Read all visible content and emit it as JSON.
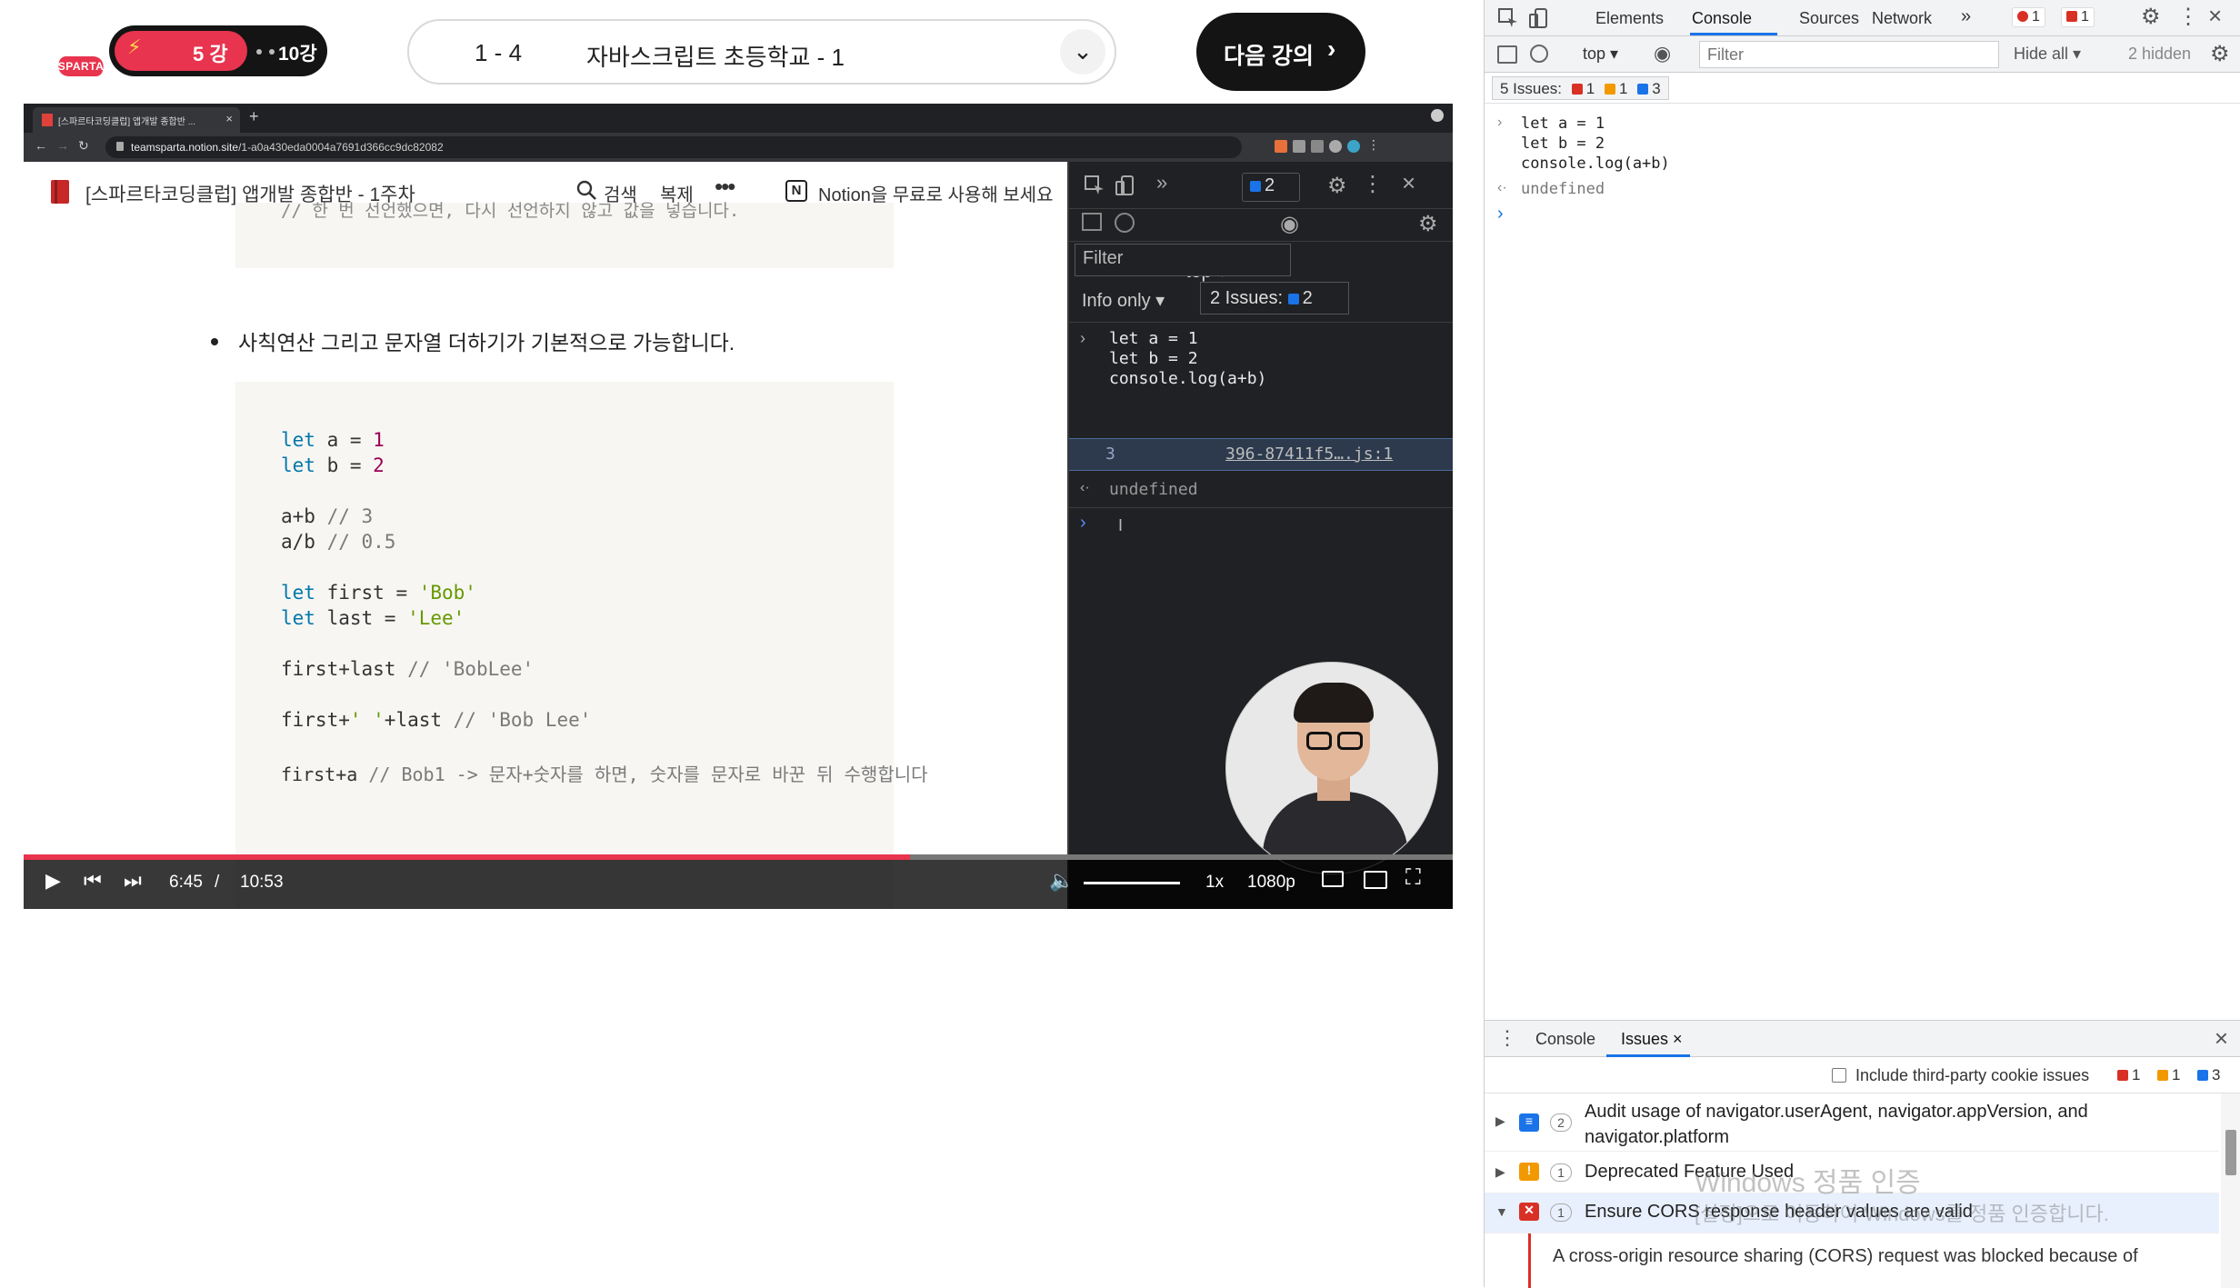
{
  "header": {
    "logo_text": "SPARTA",
    "current_lesson": "5 강",
    "total_lessons": "10강",
    "progress_icon": "lightning-bolt-icon",
    "lesson_number": "1 - 4",
    "lesson_title": "자바스크립트 초등학교 - 1",
    "next_button": "다음 강의",
    "next_icon": "chevron-right-icon",
    "accent_color": "#e8344e"
  },
  "browser": {
    "tab_title": "[스파르타코딩클럽] 앱개발 종합반 ...",
    "url_domain": "teamsparta.notion.site",
    "url_path": "/1-a0a430eda0004a7691d366cc9dc82082"
  },
  "notion": {
    "page_title": "[스파르타코딩클럽] 앱개발 종합반 - 1주차",
    "search": "검색",
    "duplicate": "복제",
    "more": "•••",
    "logo_letter": "N",
    "cta": "Notion을 무료로 사용해 보세요",
    "prev_code_line": "// 한 번 선언했으면, 다시 선언하지 않고 값을 넣습니다.",
    "bullet_text": "사칙연산 그리고 문자열 더하기가 기본적으로 가능합니다.",
    "code": {
      "l1_kw": "let",
      "l1_rest": " a = ",
      "l1_num": "1",
      "l2_kw": "let",
      "l2_rest": " b = ",
      "l2_num": "2",
      "l3": "a+b",
      "l3_cm": " // 3",
      "l4": "a/b",
      "l4_cm": " // 0.5",
      "l5_kw": "let",
      "l5_rest": " first = ",
      "l5_str": "'Bob'",
      "l6_kw": "let",
      "l6_rest": " last = ",
      "l6_str": "'Lee'",
      "l7": "first+last",
      "l7_cm": " // 'BobLee'",
      "l8a": "first+",
      "l8_str": "' '",
      "l8b": "+last",
      "l8_cm": " // 'Bob Lee'",
      "l9": "first+a",
      "l9_cm": " // Bob1 -> 문자+숫자를 하면, 숫자를 문자로 바꾼 뒤 수행합니다"
    }
  },
  "video_devtools": {
    "issues_count": "2",
    "context": "top",
    "filter_placeholder": "Filter",
    "log_level": "Info only",
    "issues_label": "2 Issues:",
    "issues_num": "2",
    "code_l1": "let a = 1",
    "code_l2": "let b = 2",
    "code_l3": "console.log(a+b)",
    "result": "3",
    "source": "396-87411f5….js:1",
    "undefined": "undefined"
  },
  "player": {
    "time_current": "6:45",
    "time_separator": "/",
    "time_total": "10:53",
    "progress_fraction": 0.62,
    "speed": "1x",
    "quality": "1080p"
  },
  "devtools": {
    "tabs": [
      "Elements",
      "Console",
      "Sources",
      "Network"
    ],
    "more_tabs": "»",
    "error_badge": "1",
    "issue_badge": "1",
    "context": "top",
    "filter_placeholder": "Filter",
    "hide_all": "Hide all",
    "hidden_count": "2 hidden",
    "issues_summary": "5 Issues:",
    "issues_red": "1",
    "issues_amber": "1",
    "issues_blue": "3",
    "console_l1": "let a = 1",
    "console_l2": "let b = 2",
    "console_l3": "console.log(a+b)",
    "console_result": "undefined",
    "prompt": "›"
  },
  "drawer": {
    "tab_console": "Console",
    "tab_issues": "Issues",
    "third_party_label": "Include third-party cookie issues",
    "count_red": "1",
    "count_amber": "1",
    "count_blue": "3",
    "issues": [
      {
        "text": "Audit usage of navigator.userAgent, navigator.appVersion, and navigator.platform",
        "count": "2"
      },
      {
        "text": "Deprecated Feature Used",
        "count": "1"
      },
      {
        "text": "Ensure CORS response header values are valid",
        "count": "1"
      }
    ],
    "detail": "A cross-origin resource sharing (CORS) request was blocked because of"
  },
  "watermark": {
    "line1": "Windows 정품 인증",
    "line2": "[설정]으로 이동하여 Windows를 정품 인증합니다."
  }
}
